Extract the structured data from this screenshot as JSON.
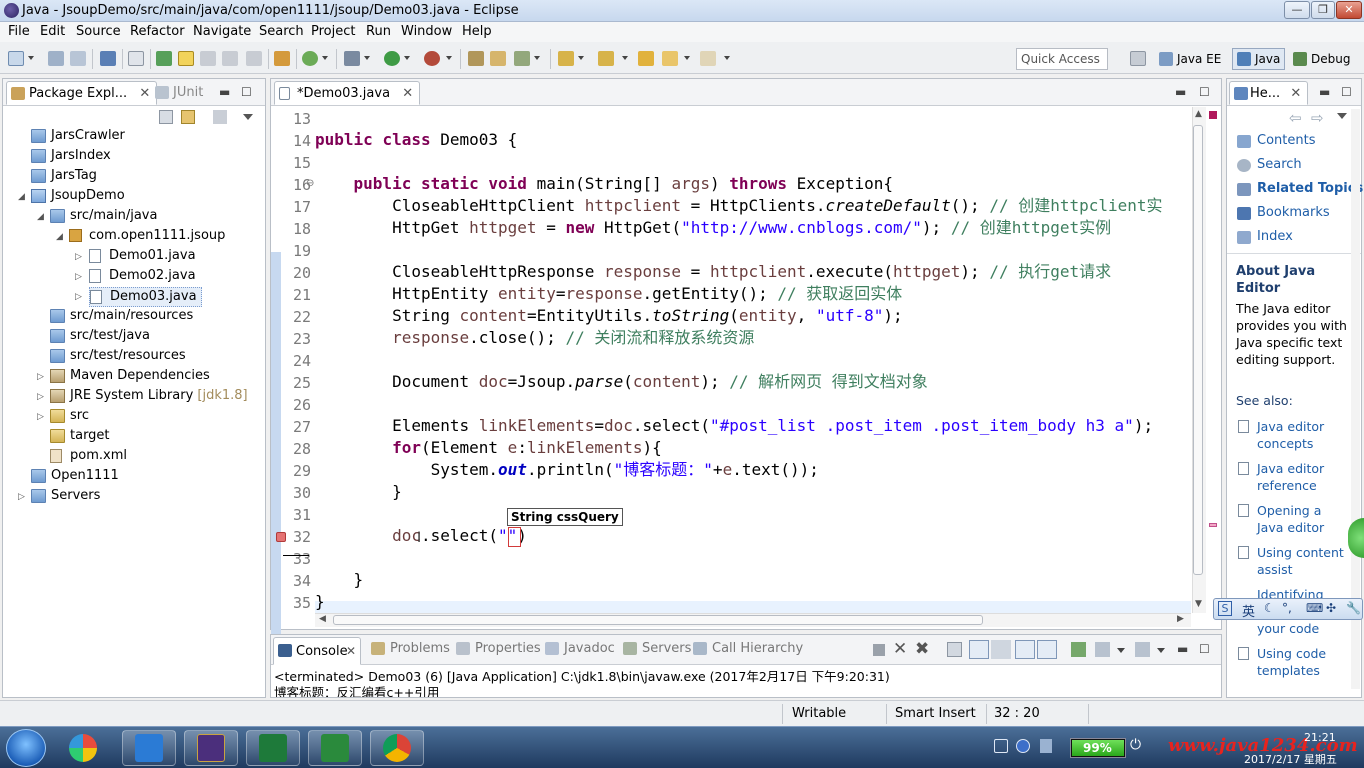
{
  "window": {
    "title": "Java - JsoupDemo/src/main/java/com/open1111/jsoup/Demo03.java - Eclipse"
  },
  "menu": [
    "File",
    "Edit",
    "Source",
    "Refactor",
    "Navigate",
    "Search",
    "Project",
    "Run",
    "Window",
    "Help"
  ],
  "quick_access": "Quick Access",
  "perspectives": [
    "Java EE",
    "Java",
    "Debug"
  ],
  "explorer": {
    "tabs": [
      "Package Expl...",
      "JUnit"
    ],
    "tree": [
      {
        "label": "JarsCrawler",
        "kind": "project"
      },
      {
        "label": "JarsIndex",
        "kind": "project"
      },
      {
        "label": "JarsTag",
        "kind": "project"
      },
      {
        "label": "JsoupDemo",
        "kind": "project"
      },
      {
        "label": "src/main/java",
        "kind": "folder"
      },
      {
        "label": "com.open1111.jsoup",
        "kind": "package"
      },
      {
        "label": "Demo01.java",
        "kind": "java"
      },
      {
        "label": "Demo02.java",
        "kind": "java"
      },
      {
        "label": "Demo03.java",
        "kind": "java"
      },
      {
        "label": "src/main/resources",
        "kind": "folder"
      },
      {
        "label": "src/test/java",
        "kind": "folder"
      },
      {
        "label": "src/test/resources",
        "kind": "folder"
      },
      {
        "label": "Maven Dependencies",
        "kind": "jar"
      },
      {
        "label": "JRE System Library",
        "decor": "[jdk1.8]",
        "kind": "jar"
      },
      {
        "label": "src",
        "kind": "folder"
      },
      {
        "label": "target",
        "kind": "folder"
      },
      {
        "label": "pom.xml",
        "kind": "xml"
      },
      {
        "label": "Open1111",
        "kind": "project"
      },
      {
        "label": "Servers",
        "kind": "project"
      }
    ]
  },
  "editor": {
    "tab": "*Demo03.java",
    "line_numbers": [
      "13",
      "14",
      "15",
      "16",
      "17",
      "18",
      "19",
      "20",
      "21",
      "22",
      "23",
      "24",
      "25",
      "26",
      "27",
      "28",
      "29",
      "30",
      "31",
      "32",
      "33",
      "34",
      "35"
    ],
    "lines": [
      "",
      "public class Demo03 {",
      "",
      "    public static void main(String[] args) throws Exception{",
      "        CloseableHttpClient httpclient = HttpClients.createDefault(); // 创建httpclient实",
      "        HttpGet httpget = new HttpGet(\"http://www.cnblogs.com/\"); // 创建httpget实例",
      "",
      "        CloseableHttpResponse response = httpclient.execute(httpget); // 执行get请求",
      "        HttpEntity entity=response.getEntity(); // 获取返回实体",
      "        String content=EntityUtils.toString(entity, \"utf-8\");",
      "        response.close(); // 关闭流和释放系统资源",
      "",
      "        Document doc=Jsoup.parse(content); // 解析网页 得到文档对象",
      "",
      "        Elements linkElements=doc.select(\"#post_list .post_item .post_item_body h3 a\");",
      "        for(Element e:linkElements){",
      "            System.out.println(\"博客标题：\"+e.text());",
      "        }",
      "",
      "        doc.select(\"\")",
      "",
      "    }",
      "}"
    ],
    "tooltip": "String cssQuery"
  },
  "help": {
    "tab": "He...",
    "links": [
      "Contents",
      "Search",
      "Related Topics",
      "Bookmarks",
      "Index"
    ],
    "about_title": "About Java Editor",
    "about_text": "The Java editor provides you with Java specific text editing support.",
    "see_also": "See also:",
    "see_links": [
      "Java editor concepts",
      "Java editor reference",
      "Opening a Java editor",
      "Using content assist",
      "Identifying",
      "your code",
      "Using code templates"
    ]
  },
  "console": {
    "tabs": [
      "Console",
      "Problems",
      "Properties",
      "Javadoc",
      "Servers",
      "Call Hierarchy"
    ],
    "status": "<terminated> Demo03 (6) [Java Application] C:\\jdk1.8\\bin\\javaw.exe (2017年2月17日 下午9:20:31)",
    "output": "博客标题：反汇编看c++引用"
  },
  "statusbar": {
    "mode": "Writable",
    "insert": "Smart Insert",
    "position": "32 : 20"
  },
  "taskbar": {
    "battery": "99%",
    "watermark": "www.java1234.com",
    "date": "2017/2/17 星期五",
    "time": "21:21",
    "ime": "英"
  },
  "colors": {
    "keyword": "#7f0055",
    "string": "#2a00ff",
    "comment": "#3f7f5f",
    "variable": "#6a3e3e",
    "field": "#0000c0",
    "watermark": "#e8231e"
  }
}
